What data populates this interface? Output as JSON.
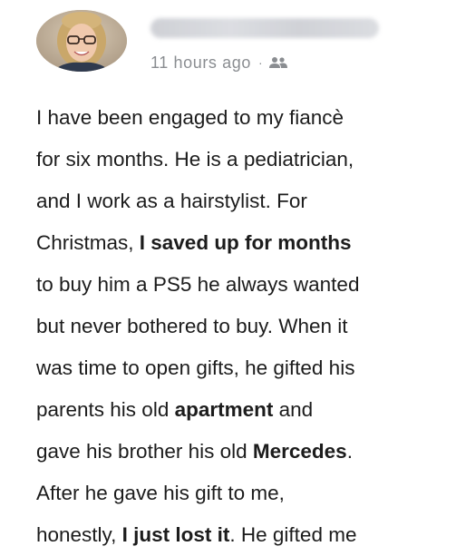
{
  "post": {
    "timestamp": "11 hours ago",
    "separator": "·",
    "audience_icon": "friends-icon",
    "lines": [
      [
        {
          "text": "I have been engaged to my fiancè"
        }
      ],
      [
        {
          "text": "for six months. He is a pediatrician,"
        }
      ],
      [
        {
          "text": "and I work as a hairstylist. For"
        }
      ],
      [
        {
          "text": "Christmas, "
        },
        {
          "text": "I saved up for months",
          "bold": true
        }
      ],
      [
        {
          "text": "to buy him a PS5 he always wanted"
        }
      ],
      [
        {
          "text": "but never bothered to buy. When it"
        }
      ],
      [
        {
          "text": "was time to open gifts, he gifted his"
        }
      ],
      [
        {
          "text": "parents his old "
        },
        {
          "text": "apartment",
          "bold": true
        },
        {
          "text": " and"
        }
      ],
      [
        {
          "text": "gave his brother his old "
        },
        {
          "text": "Mercedes",
          "bold": true
        },
        {
          "text": "."
        }
      ],
      [
        {
          "text": "After he gave his gift to me,"
        }
      ],
      [
        {
          "text": "honestly, "
        },
        {
          "text": "I just lost it",
          "bold": true
        },
        {
          "text": ". He gifted me"
        }
      ]
    ]
  },
  "colors": {
    "text": "#1c1c1c",
    "meta": "#8a8d91",
    "background": "#ffffff"
  }
}
